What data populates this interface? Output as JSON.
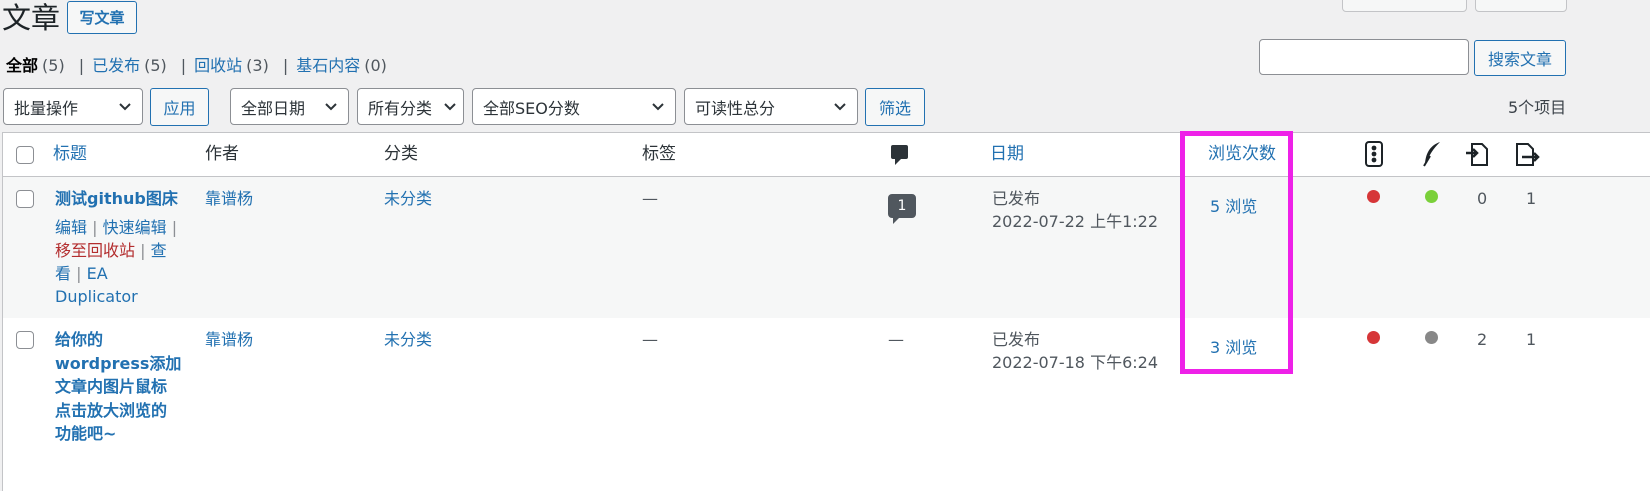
{
  "header": {
    "title": "文章",
    "add_new": "写文章"
  },
  "views_filter": [
    {
      "label": "全部",
      "count": "(5)",
      "current": true
    },
    {
      "label": "已发布",
      "count": "(5)"
    },
    {
      "label": "回收站",
      "count": "(3)"
    },
    {
      "label": "基石内容",
      "count": "(0)"
    }
  ],
  "search": {
    "value": "",
    "button": "搜索文章"
  },
  "filters": {
    "bulk_action": "批量操作",
    "apply": "应用",
    "date": "全部日期",
    "category": "所有分类",
    "seo": "全部SEO分数",
    "readability": "可读性总分",
    "filter": "筛选",
    "items_count": "5个项目"
  },
  "columns": {
    "title": "标题",
    "author": "作者",
    "categories": "分类",
    "tags": "标签",
    "comments_icon": "comment-icon",
    "date": "日期",
    "views": "浏览次数",
    "seo_icon": "traffic-light-icon",
    "readability_icon": "feather-icon",
    "inbound_icon": "link-in-icon",
    "outbound_icon": "link-out-icon"
  },
  "posts": [
    {
      "title": "测试github图床",
      "actions": {
        "edit": "编辑",
        "quick_edit": "快速编辑",
        "trash": "移至回收站",
        "view_1": "查",
        "view_2": "看",
        "dup_1": "EA",
        "dup_2": "Duplicator"
      },
      "author": "靠谱杨",
      "category": "未分类",
      "tags": "—",
      "comments": "1",
      "status": "已发布",
      "date": "2022-07-22 上午1:22",
      "views": "5 浏览",
      "seo_color": "#d63638",
      "readability_color": "#7ad03a",
      "inbound": "0",
      "outbound": "1"
    },
    {
      "title_lines": [
        "给你的",
        "wordpress添加",
        "文章内图片鼠标",
        "点击放大浏览的",
        "功能吧~"
      ],
      "author": "靠谱杨",
      "category": "未分类",
      "tags": "—",
      "comments": "—",
      "status": "已发布",
      "date": "2022-07-18 下午6:24",
      "views": "3 浏览",
      "seo_color": "#d63638",
      "readability_color": "#888888",
      "inbound": "2",
      "outbound": "1"
    }
  ],
  "highlight_color": "#ee21e8"
}
